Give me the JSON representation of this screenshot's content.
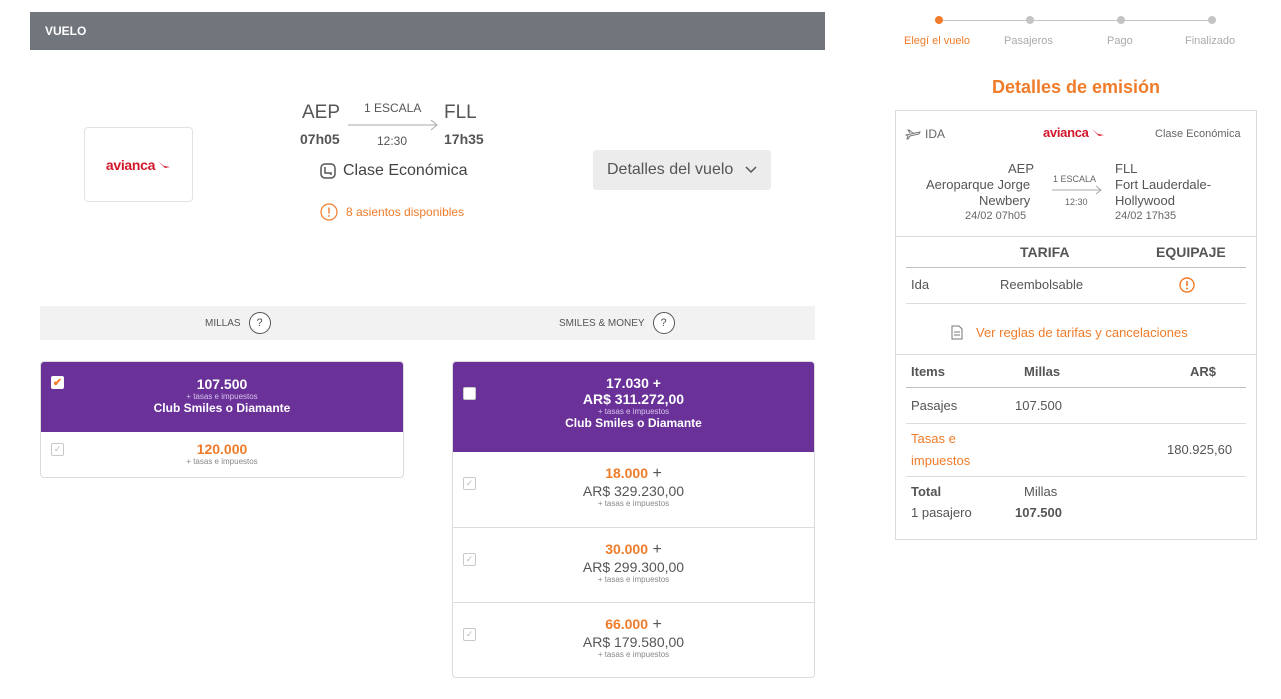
{
  "header": {
    "title": "VUELO"
  },
  "flight": {
    "airline": "avianca",
    "origin_code": "AEP",
    "origin_time": "07h05",
    "dest_code": "FLL",
    "dest_time": "17h35",
    "stops": "1 ESCALA",
    "duration": "12:30",
    "cabin": "Clase Económica",
    "seats": "8 asientos disponibles",
    "details_button": "Detalles del vuelo"
  },
  "tabs": [
    {
      "label": "MILLAS",
      "help": "?"
    },
    {
      "label": "SMILES & MONEY",
      "help": "?"
    }
  ],
  "millas_options": [
    {
      "miles": "107.500",
      "tax": "+ tasas e impuestos",
      "club": "Club Smiles o Diamante",
      "selected": true
    },
    {
      "miles": "120.000",
      "tax": "+ tasas e impuestos",
      "selected": false
    }
  ],
  "smiles_money_options": [
    {
      "miles": "17.030 +",
      "money": "AR$ 311.272,00",
      "tax": "+ tasas e impuestos",
      "club": "Club Smiles o Diamante",
      "selected": true
    },
    {
      "miles": "18.000",
      "plus": "+",
      "money": "AR$ 329.230,00",
      "tax": "+ tasas e impuestos",
      "selected": false
    },
    {
      "miles": "30.000",
      "plus": "+",
      "money": "AR$ 299.300,00",
      "tax": "+ tasas e impuestos",
      "selected": false
    },
    {
      "miles": "66.000",
      "plus": "+",
      "money": "AR$ 179.580,00",
      "tax": "+ tasas e impuestos",
      "selected": false
    }
  ],
  "stepper": {
    "steps": [
      "Elegí el vuelo",
      "Pasajeros",
      "Pago",
      "Finalizado"
    ],
    "active_index": 0
  },
  "summary": {
    "title": "Detalles de emisión",
    "direction": "IDA",
    "airline": "avianca",
    "cabin": "Clase Económica",
    "origin_code": "AEP",
    "origin_name_1": "Aeroparque Jorge",
    "origin_name_2": "Newbery",
    "origin_datetime": "24/02 07h05",
    "stops": "1 ESCALA",
    "duration": "12:30",
    "dest_code": "FLL",
    "dest_name_1": "Fort Lauderdale-",
    "dest_name_2": "Hollywood",
    "dest_datetime": "24/02 17h35",
    "col_tarifa": "TARIFA",
    "col_equipaje": "EQUIPAJE",
    "fare_leg": "Ida",
    "fare_type": "Reembolsable",
    "rules_link": "Ver reglas de tarifas y cancelaciones",
    "items_header": {
      "items": "Items",
      "millas": "Millas",
      "ars": "AR$"
    },
    "pasajes_label": "Pasajes",
    "pasajes_millas": "107.500",
    "tasas_label_1": "Tasas e",
    "tasas_label_2": "impuestos",
    "tasas_ars": "180.925,60",
    "total_label": "Total",
    "total_pax": "1 pasajero",
    "total_millas_label": "Millas",
    "total_millas": "107.500"
  },
  "colors": {
    "accent": "#f07c2a",
    "selected": "#6a3199",
    "header": "#71757c",
    "airline_red": "#d3172b"
  }
}
